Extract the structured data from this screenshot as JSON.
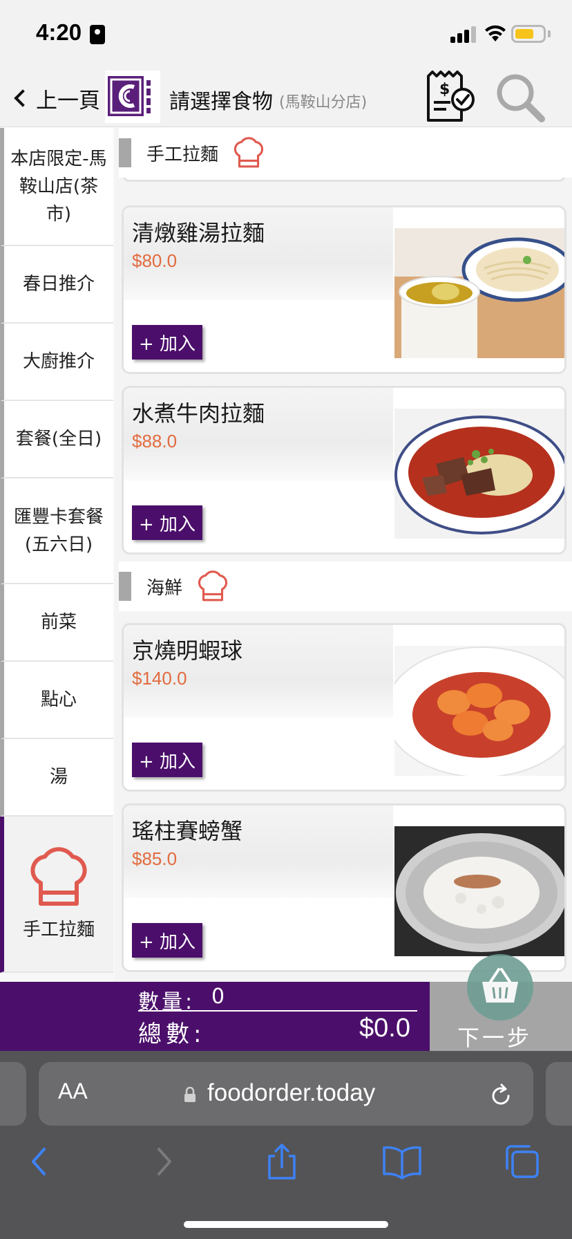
{
  "status_bar": {
    "time": "4:20"
  },
  "header": {
    "back_label": "上一頁",
    "title": "請選擇食物",
    "subtitle": "(馬鞍山分店)"
  },
  "sidebar": {
    "items": [
      {
        "label": "本店限定-馬鞍山店(茶市)"
      },
      {
        "label": "春日推介"
      },
      {
        "label": "大廚推介"
      },
      {
        "label": "套餐(全日)"
      },
      {
        "label": "匯豐卡套餐(五六日)"
      },
      {
        "label": "前菜"
      },
      {
        "label": "點心"
      },
      {
        "label": "湯"
      },
      {
        "label": "手工拉麵",
        "active": true
      }
    ]
  },
  "sections": [
    {
      "label": "手工拉麵"
    },
    {
      "label": "海鮮"
    }
  ],
  "menu_items": [
    {
      "name": "清燉雞湯拉麵",
      "price": "$80.0",
      "add_label": "+ 加入"
    },
    {
      "name": "水煮牛肉拉麵",
      "price": "$88.0",
      "add_label": "+ 加入"
    },
    {
      "name": "京燒明蝦球",
      "price": "$140.0",
      "add_label": "+ 加入"
    },
    {
      "name": "瑤柱賽螃蟹",
      "price": "$85.0",
      "add_label": "+ 加入"
    }
  ],
  "order_bar": {
    "qty_label": "數量:",
    "qty_value": "0",
    "total_label": "總數:",
    "total_value": "$0.0",
    "next_label": "下一步"
  },
  "browser": {
    "aa_label": "AA",
    "url": "foodorder.today"
  },
  "colors": {
    "brand_purple": "#4b0f6b",
    "price_orange": "#e26b3f",
    "chef_icon_red": "#e05a4f",
    "safari_blue": "#3d82f6"
  }
}
